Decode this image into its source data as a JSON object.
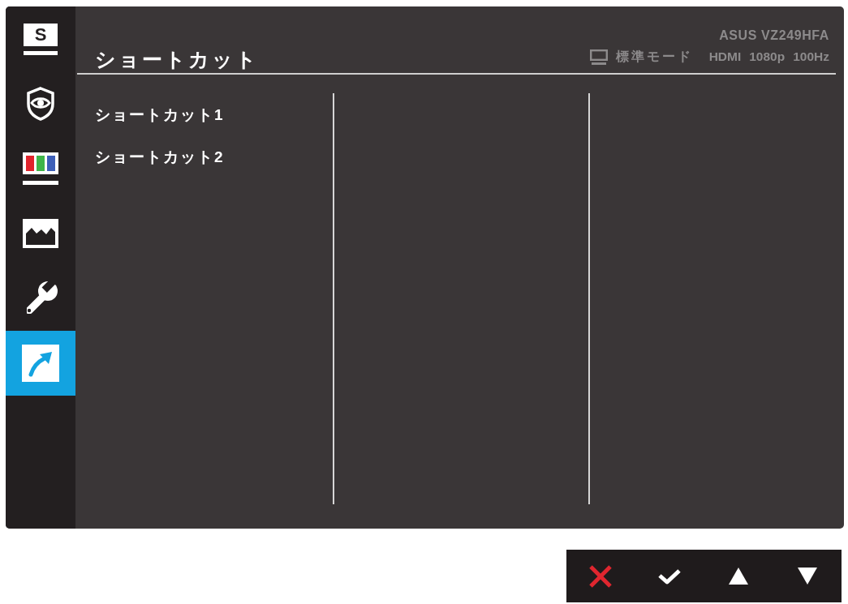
{
  "sidebar": {
    "items": [
      {
        "kind": "letter",
        "label": "S",
        "selected": false
      },
      {
        "kind": "eye-shield",
        "selected": false
      },
      {
        "kind": "color-bars",
        "selected": false
      },
      {
        "kind": "picture",
        "selected": false
      },
      {
        "kind": "wrench",
        "selected": false
      },
      {
        "kind": "arrow",
        "selected": true
      }
    ]
  },
  "header": {
    "title": "ショートカット",
    "model": "ASUS VZ249HFA",
    "mode": "標準モード",
    "signal": [
      "HDMI",
      "1080p",
      "100Hz"
    ]
  },
  "menu": {
    "items": [
      {
        "label": "ショートカット1",
        "selected": false
      },
      {
        "label": "ショートカット2",
        "selected": false
      }
    ]
  },
  "keys": [
    {
      "kind": "close"
    },
    {
      "kind": "confirm"
    },
    {
      "kind": "up"
    },
    {
      "kind": "down"
    }
  ]
}
